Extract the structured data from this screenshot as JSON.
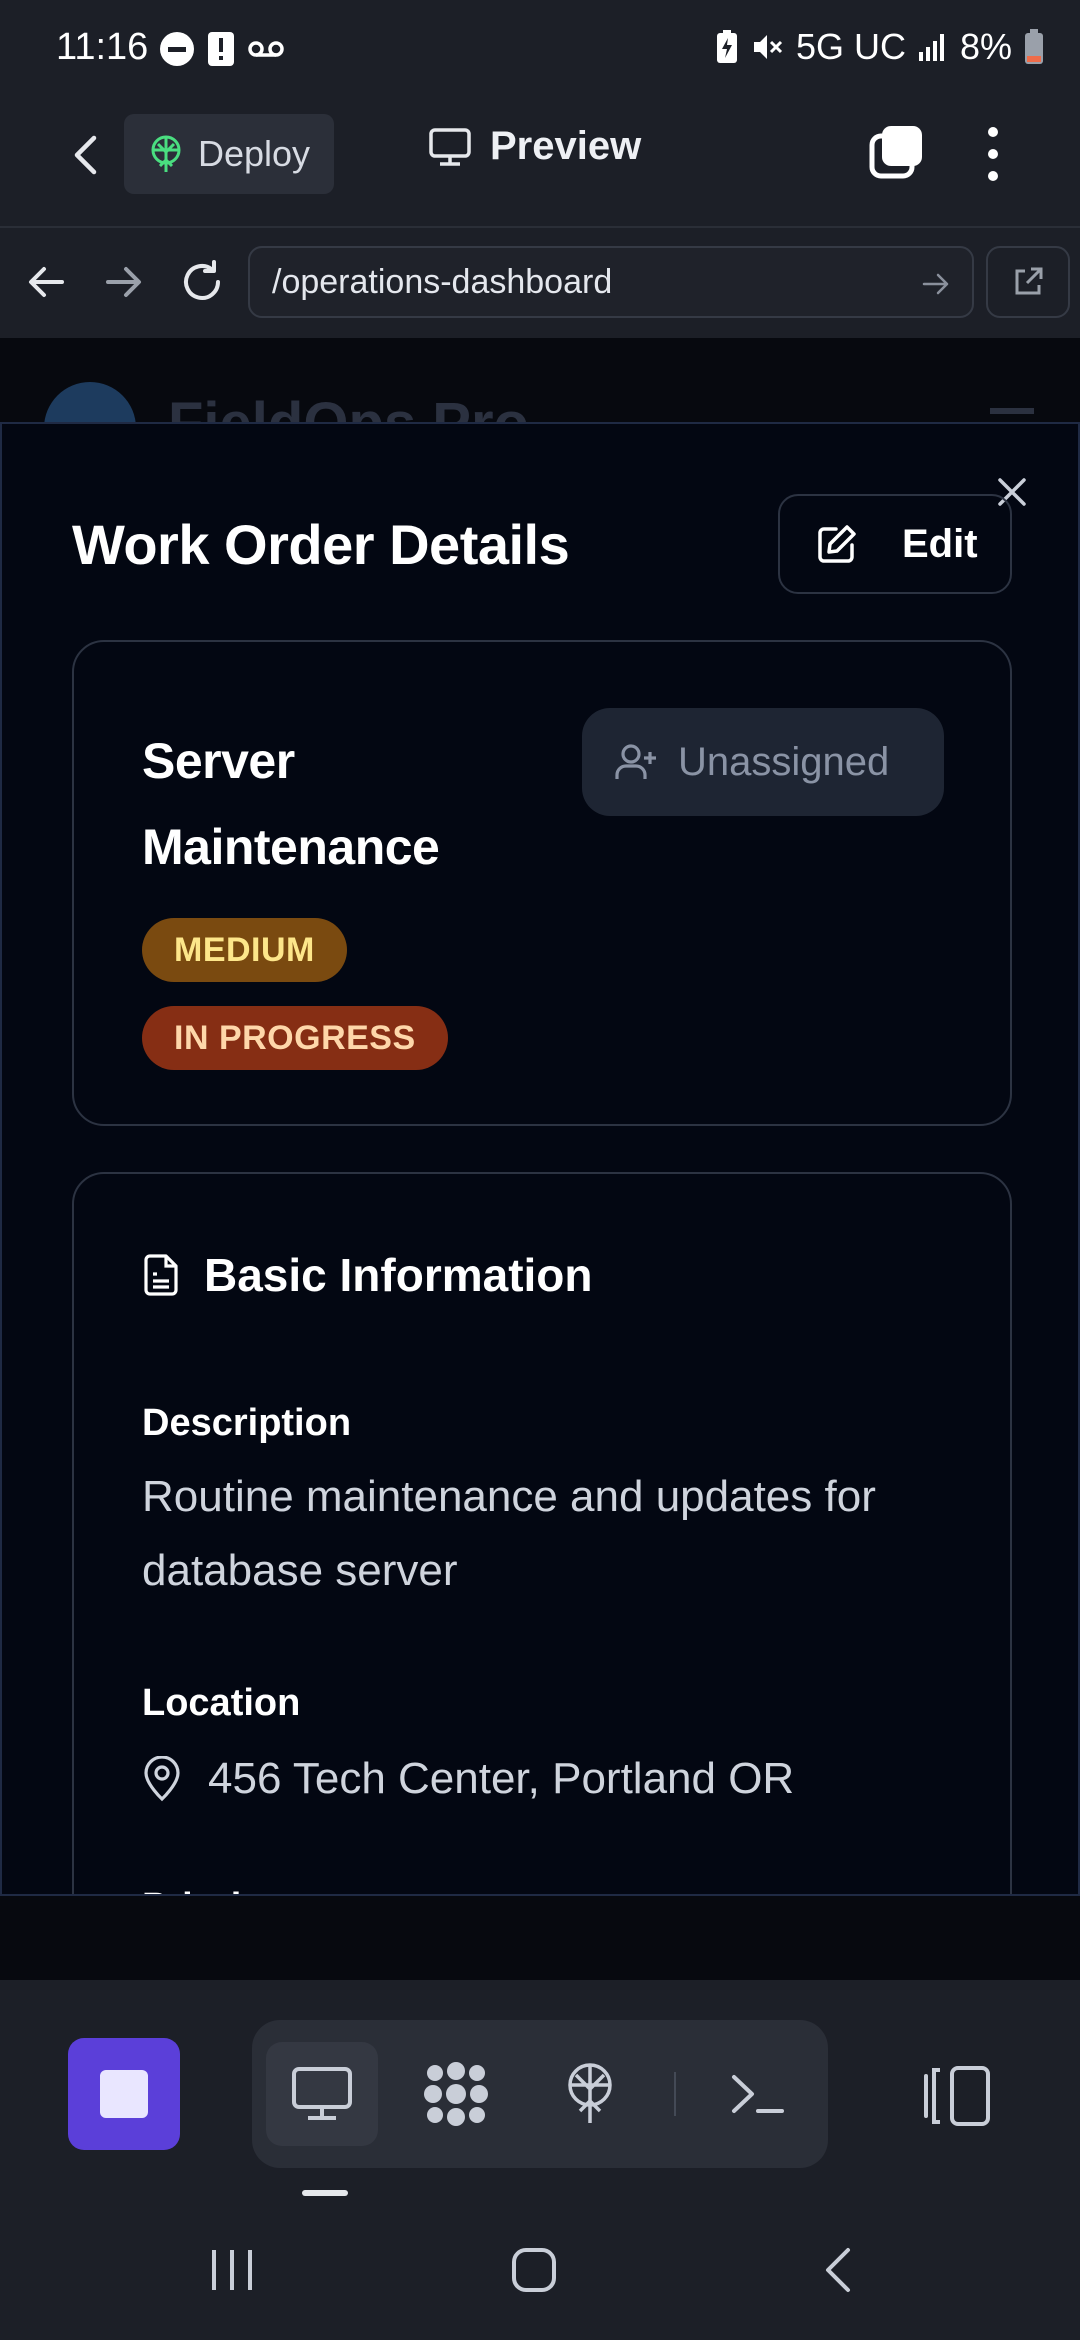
{
  "status_bar": {
    "time": "11:16",
    "network": "5G UC",
    "battery": "8%",
    "icons": [
      "do-not-disturb-icon",
      "alert-icon",
      "voicemail-icon",
      "battery-saver-icon",
      "mute-icon",
      "signal-icon",
      "battery-icon"
    ]
  },
  "toolbar": {
    "deploy_label": "Deploy",
    "preview_label": "Preview"
  },
  "url_bar": {
    "url": "/operations-dashboard"
  },
  "background_page": {
    "brand": "FieldOps Pro"
  },
  "modal": {
    "title": "Work Order Details",
    "edit_label": "Edit",
    "work_order": {
      "title": "Server Maintenance",
      "assignee_label": "Unassigned",
      "priority_badge": "MEDIUM",
      "status_badge": "IN PROGRESS"
    },
    "basic_info": {
      "heading": "Basic Information",
      "description_label": "Description",
      "description": "Routine maintenance and updates for database server",
      "location_label": "Location",
      "location": "456 Tech Center, Portland OR",
      "priority_label": "Priority"
    }
  },
  "colors": {
    "accent": "#5b3fd9",
    "medium_badge_bg": "#7a4a10",
    "medium_badge_text": "#fde68a",
    "progress_badge_bg": "#862e14",
    "progress_badge_text": "#fed7aa"
  }
}
